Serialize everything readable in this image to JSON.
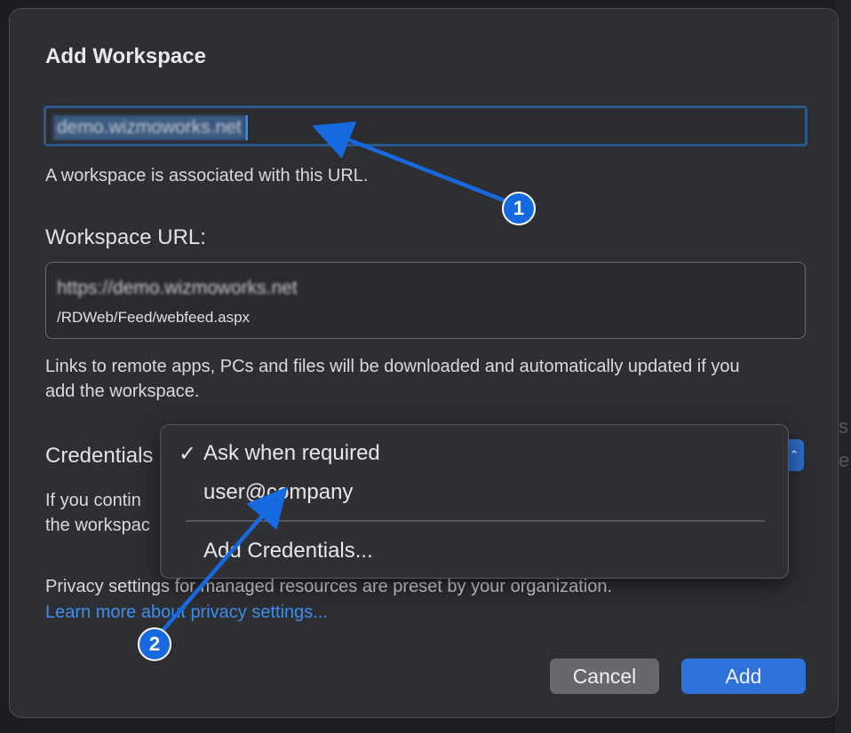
{
  "dialog": {
    "title": "Add Workspace",
    "email_field_value": "demo.wizmoworks.net",
    "email_hint": "A workspace is associated with this URL.",
    "workspace_url_label": "Workspace URL:",
    "workspace_url_line1": "https://demo.wizmoworks.net",
    "workspace_url_line2": "/RDWeb/Feed/webfeed.aspx",
    "description": "Links to remote apps, PCs and files will be downloaded and automatically updated if you add the workspace.",
    "credentials_label": "Credentials",
    "continue_text_line1": "If you contin",
    "continue_text_line2": "the workspac",
    "privacy_text": "Privacy settings for managed resources are preset by your organization.",
    "privacy_link": "Learn more about privacy settings...",
    "cancel_label": "Cancel",
    "add_label": "Add"
  },
  "credentials_menu": {
    "items": [
      {
        "label": "Ask when required",
        "checked": true
      },
      {
        "label": "user@company",
        "checked": false
      },
      {
        "label": "Add Credentials...",
        "checked": false
      }
    ],
    "check_glyph": "✓"
  },
  "annotations": {
    "badge1": "1",
    "badge2": "2"
  },
  "colors": {
    "accent": "#2e71d9",
    "link": "#3d8ef0",
    "annotation": "#1769e0"
  }
}
